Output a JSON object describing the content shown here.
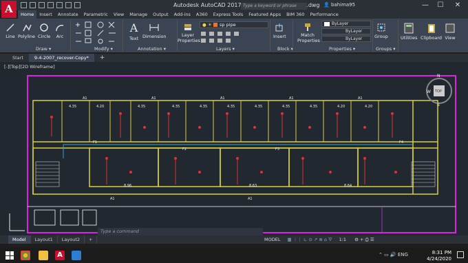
{
  "window": {
    "title": "Autodesk AutoCAD 2017   9-4-2007_recover-Copy.dwg",
    "search_placeholder": "Type a keyword or phrase",
    "user": "bahima95",
    "minimize": "—",
    "maximize": "☐",
    "close": "✕"
  },
  "app_button": "A",
  "ribbon_tabs": [
    "Home",
    "Insert",
    "Annotate",
    "Parametric",
    "View",
    "Manage",
    "Output",
    "Add-ins",
    "A360",
    "Express Tools",
    "Featured Apps",
    "BIM 360",
    "Performance"
  ],
  "ribbon": {
    "draw": {
      "line": "Line",
      "polyline": "Polyline",
      "circle": "Circle",
      "arc": "Arc",
      "panel": "Draw ▾"
    },
    "modify": {
      "panel": "Modify ▾"
    },
    "annotation": {
      "text": "Text",
      "dimension": "Dimension",
      "panel": "Annotation ▾"
    },
    "layers": {
      "layer_properties": "Layer Properties",
      "current_layer": "sp pipe",
      "panel": "Layers ▾"
    },
    "block": {
      "insert": "Insert",
      "panel": "Block ▾"
    },
    "properties": {
      "match": "Match Properties",
      "color": "ByLayer",
      "linetype": "ByLayer",
      "lineweight": "ByLayer",
      "panel": "Properties ▾"
    },
    "groups": {
      "group": "Group",
      "panel": "Groups ▾"
    },
    "utilities": "Utilities",
    "clipboard": "Clipboard",
    "view": "View"
  },
  "file_tabs": [
    "Start",
    "9-4-2007_recover-Copy*"
  ],
  "viewport": {
    "label": "[-][Top][2D Wireframe]",
    "viewcube": {
      "top": "TOP",
      "n": "N",
      "s": "S",
      "w": "W",
      "e": "E"
    },
    "dims": [
      "4.35",
      "4.20",
      "4.35",
      "4.35",
      "4.35",
      "4.35",
      "4.35",
      "4.35",
      "4.35",
      "4.20",
      "4.20"
    ],
    "bottom_dims": [
      "8.96",
      "8.63",
      "8.64"
    ],
    "room_tags": [
      "F1",
      "F2",
      "F3",
      "F4",
      "F5",
      "F6",
      "F7",
      "F8",
      "F9",
      "F10"
    ],
    "axis_labels": [
      "A1",
      "A1",
      "A1",
      "A1",
      "A1",
      "A1",
      "A1"
    ]
  },
  "command_placeholder": "Type a command",
  "layout_tabs": [
    "Model",
    "Layout1",
    "Layout2"
  ],
  "status": {
    "model": "MODEL",
    "scale": "1:1"
  },
  "taskbar": {
    "time": "8:31 PM",
    "date": "4/24/2020",
    "lang": "ENG"
  }
}
